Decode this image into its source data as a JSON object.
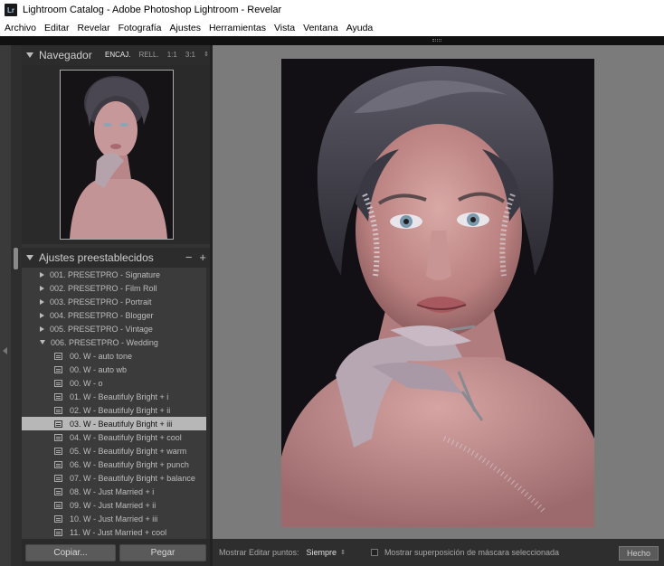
{
  "window": {
    "title": "Lightroom Catalog - Adobe Photoshop Lightroom - Revelar",
    "app_icon": "Lr"
  },
  "menu": [
    "Archivo",
    "Editar",
    "Revelar",
    "Fotografía",
    "Ajustes",
    "Herramientas",
    "Vista",
    "Ventana",
    "Ayuda"
  ],
  "navigator": {
    "title": "Navegador",
    "zoom_options": [
      "ENCAJ.",
      "RELL.",
      "1:1",
      "3:1"
    ],
    "zoom_active": "ENCAJ.",
    "zoom_arrows": "⇕"
  },
  "presets": {
    "title": "Ajustes preestablecidos",
    "minus": "−",
    "plus": "+",
    "rows": [
      {
        "label": "001. PRESETPRO - Signature",
        "kind": "folder"
      },
      {
        "label": "002. PRESETPRO - Film Roll",
        "kind": "folder"
      },
      {
        "label": "003. PRESETPRO - Portrait",
        "kind": "folder"
      },
      {
        "label": "004. PRESETPRO - Blogger",
        "kind": "folder"
      },
      {
        "label": "005. PRESETPRO - Vintage",
        "kind": "folder"
      },
      {
        "label": "006. PRESETPRO - Wedding",
        "kind": "open-folder"
      },
      {
        "label": "00. W - auto tone",
        "kind": "preset"
      },
      {
        "label": "00. W - auto wb",
        "kind": "preset"
      },
      {
        "label": "00. W - o",
        "kind": "preset"
      },
      {
        "label": "01. W - Beautifuly Bright + i",
        "kind": "preset"
      },
      {
        "label": "02. W - Beautifuly Bright + ii",
        "kind": "preset"
      },
      {
        "label": "03. W - Beautifuly Bright + iii",
        "kind": "preset",
        "selected": true
      },
      {
        "label": "04. W - Beautifuly Bright + cool",
        "kind": "preset"
      },
      {
        "label": "05. W - Beautifuly Bright + warm",
        "kind": "preset"
      },
      {
        "label": "06. W - Beautifuly Bright + punch",
        "kind": "preset"
      },
      {
        "label": "07. W - Beautifuly Bright + balance",
        "kind": "preset"
      },
      {
        "label": "08. W - Just Married + i",
        "kind": "preset"
      },
      {
        "label": "09. W - Just Married + ii",
        "kind": "preset"
      },
      {
        "label": "10. W - Just Married + iii",
        "kind": "preset"
      },
      {
        "label": "11. W - Just Married + cool",
        "kind": "preset"
      }
    ]
  },
  "buttons": {
    "copy": "Copiar...",
    "paste": "Pegar",
    "done": "Hecho"
  },
  "toolbar": {
    "show_edit_points_label": "Mostrar Editar puntos:",
    "show_edit_points_value": "Siempre",
    "mask_overlay_label": "Mostrar superposición de máscara seleccionada",
    "mask_overlay_checked": false
  }
}
